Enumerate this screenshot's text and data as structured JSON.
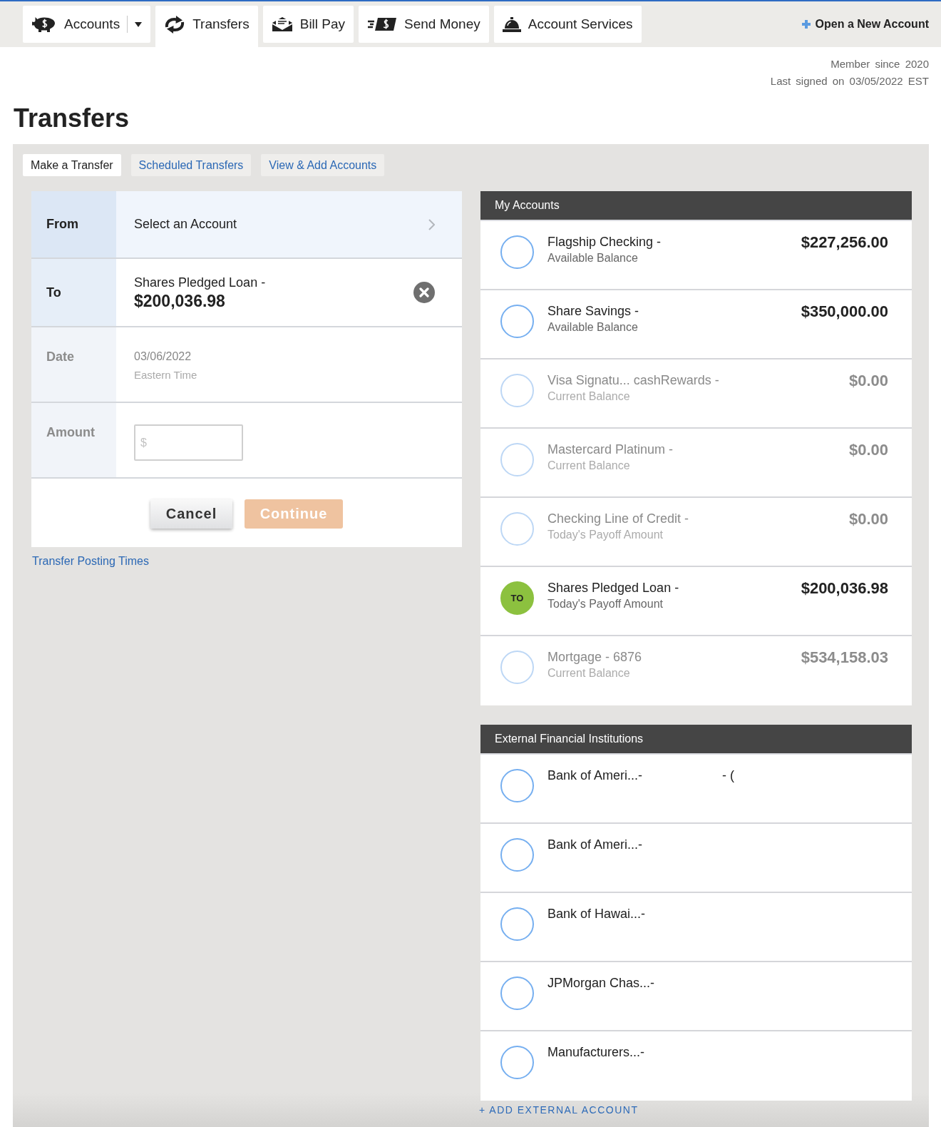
{
  "top_nav": {
    "tabs": [
      {
        "label": "Accounts",
        "selected": false,
        "has_menu": true
      },
      {
        "label": "Transfers",
        "selected": true,
        "has_menu": false
      },
      {
        "label": "Bill Pay",
        "selected": false,
        "has_menu": false
      },
      {
        "label": "Send Money",
        "selected": false,
        "has_menu": false
      },
      {
        "label": "Account Services",
        "selected": false,
        "has_menu": false
      }
    ],
    "action": "Open a New Account"
  },
  "member_info": [
    "Member since 2020",
    "Last signed on 03/05/2022 EST"
  ],
  "page_title": "Transfers",
  "sub_tabs": [
    {
      "label": "Make a Transfer",
      "selected": true
    },
    {
      "label": "Scheduled Transfers",
      "selected": false
    },
    {
      "label": "View & Add Accounts",
      "selected": false
    }
  ],
  "transfer_form": {
    "rows": [
      {
        "kind": "select",
        "label": "From",
        "value": "Select an Account",
        "active": true,
        "disabled": false
      },
      {
        "kind": "account",
        "label": "To",
        "value": "Shares Pledged Loan -",
        "amount": "$200,036.98",
        "active": false,
        "disabled": false
      },
      {
        "kind": "date",
        "label": "Date",
        "value": "03/06/2022",
        "note": "Eastern Time",
        "active": false,
        "disabled": true
      },
      {
        "kind": "amount",
        "label": "Amount",
        "placeholder": "$",
        "active": false,
        "disabled": true
      }
    ],
    "buttons": [
      {
        "label": "Cancel",
        "kind": "secondary",
        "disabled": false
      },
      {
        "label": "Continue",
        "kind": "primary",
        "disabled": true
      }
    ]
  },
  "posting_times_link": "Transfer Posting Times",
  "my_accounts": {
    "title": "My Accounts",
    "accounts": [
      {
        "name": "Flagship Checking -",
        "balance_label": "Available Balance",
        "amount": "$227,256.00",
        "selected": false,
        "disabled": false
      },
      {
        "name": "Share Savings -",
        "balance_label": "Available Balance",
        "amount": "$350,000.00",
        "selected": false,
        "disabled": false
      },
      {
        "name": "Visa Signatu... cashRewards -",
        "balance_label": "Current Balance",
        "amount": "$0.00",
        "selected": false,
        "disabled": true
      },
      {
        "name": "Mastercard Platinum -",
        "balance_label": "Current Balance",
        "amount": "$0.00",
        "selected": false,
        "disabled": true
      },
      {
        "name": "Checking Line of Credit -",
        "balance_label": "Today's Payoff Amount",
        "amount": "$0.00",
        "selected": false,
        "disabled": true
      },
      {
        "name": "Shares Pledged Loan -",
        "balance_label": "Today's Payoff Amount",
        "amount": "$200,036.98",
        "selected": true,
        "disabled": false,
        "badge": "TO"
      },
      {
        "name": "Mortgage - 6876",
        "balance_label": "Current Balance",
        "amount": "$534,158.03",
        "selected": false,
        "disabled": true
      }
    ]
  },
  "external_institutions": {
    "title": "External Financial Institutions",
    "accounts": [
      {
        "name": "Bank of Ameri...-",
        "detail": "- (",
        "selected": false
      },
      {
        "name": "Bank of Ameri...-",
        "selected": false
      },
      {
        "name": "Bank of Hawai...-",
        "selected": false
      },
      {
        "name": "JPMorgan Chas...-",
        "selected": false
      },
      {
        "name": "Manufacturers...-",
        "selected": false
      }
    ],
    "add_link": "+ ADD EXTERNAL ACCOUNT"
  }
}
